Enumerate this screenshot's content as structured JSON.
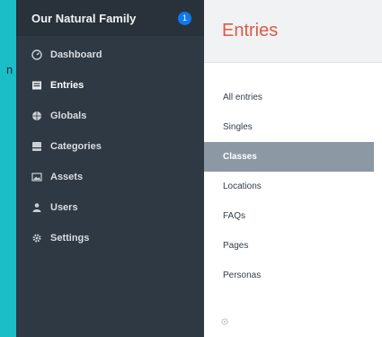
{
  "edge_text": "n",
  "sidebar": {
    "site_name": "Our Natural Family",
    "badge": "1",
    "items": [
      {
        "label": "Dashboard",
        "icon": "dashboard-icon"
      },
      {
        "label": "Entries",
        "icon": "entries-icon",
        "active": true
      },
      {
        "label": "Globals",
        "icon": "globe-icon"
      },
      {
        "label": "Categories",
        "icon": "categories-icon"
      },
      {
        "label": "Assets",
        "icon": "assets-icon"
      },
      {
        "label": "Users",
        "icon": "users-icon"
      },
      {
        "label": "Settings",
        "icon": "gear-icon"
      }
    ]
  },
  "main": {
    "title": "Entries",
    "sections": [
      {
        "label": "All entries"
      },
      {
        "label": "Singles"
      },
      {
        "label": "Classes",
        "selected": true
      },
      {
        "label": "Locations"
      },
      {
        "label": "FAQs"
      },
      {
        "label": "Pages"
      },
      {
        "label": "Personas"
      }
    ],
    "settings_icon": "gear-icon"
  },
  "colors": {
    "background": "#1bbdc7",
    "sidebar": "#2f3943",
    "title": "#da5a47",
    "selected": "#8c98a3",
    "badge": "#0d78f2"
  }
}
